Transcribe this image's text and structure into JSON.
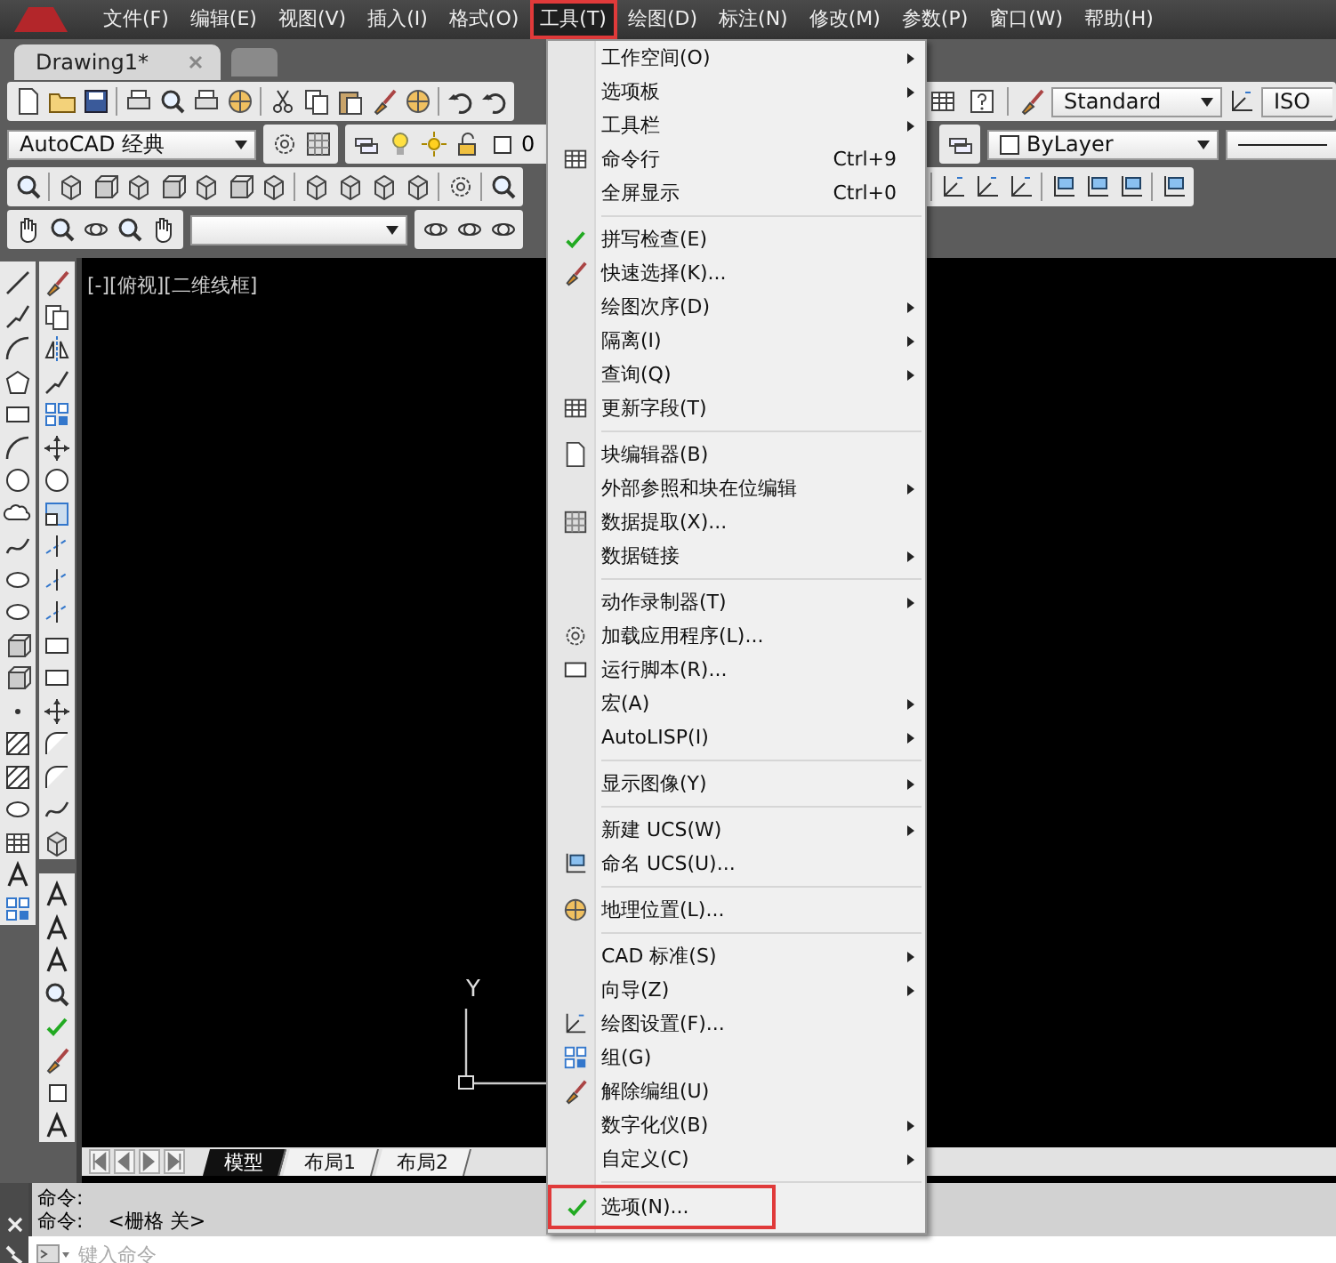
{
  "menu_bar": {
    "items": [
      {
        "label": "文件(F)",
        "selected": false,
        "callout": false
      },
      {
        "label": "编辑(E)",
        "selected": false,
        "callout": false
      },
      {
        "label": "视图(V)",
        "selected": false,
        "callout": false
      },
      {
        "label": "插入(I)",
        "selected": false,
        "callout": false
      },
      {
        "label": "格式(O)",
        "selected": false,
        "callout": false
      },
      {
        "label": "工具(T)",
        "selected": true,
        "callout": true
      },
      {
        "label": "绘图(D)",
        "selected": false,
        "callout": false
      },
      {
        "label": "标注(N)",
        "selected": false,
        "callout": false
      },
      {
        "label": "修改(M)",
        "selected": false,
        "callout": false
      },
      {
        "label": "参数(P)",
        "selected": false,
        "callout": false
      },
      {
        "label": "窗口(W)",
        "selected": false,
        "callout": false
      },
      {
        "label": "帮助(H)",
        "selected": false,
        "callout": false
      }
    ]
  },
  "document_tabs": [
    {
      "label": "Drawing1*",
      "selected": true
    }
  ],
  "toolbars": {
    "text_style": "Standard",
    "dimension_style": "ISO",
    "workspace": "AutoCAD 经典",
    "layer": "0",
    "color_setting": "ByLayer"
  },
  "viewport": {
    "label": "[-][俯视][二维线框]",
    "ucs_axis": "Y"
  },
  "layout_tabs": [
    {
      "label": "模型",
      "selected": true
    },
    {
      "label": "布局1",
      "selected": false
    },
    {
      "label": "布局2",
      "selected": false
    }
  ],
  "command_history": [
    {
      "prompt": "命令:"
    },
    {
      "prompt": "命令:",
      "message": "<栅格 关>"
    }
  ],
  "command_input": {
    "placeholder": "键入命令"
  },
  "tools_menu": {
    "sections": [
      [
        {
          "label": "工作空间(O)",
          "submenu": true,
          "callout": false
        },
        {
          "label": "选项板",
          "submenu": true,
          "callout": false
        },
        {
          "label": "工具栏",
          "submenu": true,
          "callout": false
        },
        {
          "label": "命令行",
          "shortcut": "Ctrl+9",
          "submenu": false,
          "callout": false
        },
        {
          "label": "全屏显示",
          "shortcut": "Ctrl+0",
          "submenu": false,
          "callout": false
        }
      ],
      [
        {
          "label": "拼写检查(E)",
          "submenu": false,
          "callout": false
        },
        {
          "label": "快速选择(K)...",
          "submenu": false,
          "callout": false
        },
        {
          "label": "绘图次序(D)",
          "submenu": true,
          "callout": false
        },
        {
          "label": "隔离(I)",
          "submenu": true,
          "callout": false
        },
        {
          "label": "查询(Q)",
          "submenu": true,
          "callout": false
        },
        {
          "label": "更新字段(T)",
          "submenu": false,
          "callout": false
        }
      ],
      [
        {
          "label": "块编辑器(B)",
          "submenu": false,
          "callout": false
        },
        {
          "label": "外部参照和块在位编辑",
          "submenu": true,
          "callout": false
        },
        {
          "label": "数据提取(X)...",
          "submenu": false,
          "callout": false
        },
        {
          "label": "数据链接",
          "submenu": true,
          "callout": false
        }
      ],
      [
        {
          "label": "动作录制器(T)",
          "submenu": true,
          "callout": false
        },
        {
          "label": "加载应用程序(L)...",
          "submenu": false,
          "callout": false
        },
        {
          "label": "运行脚本(R)...",
          "submenu": false,
          "callout": false
        },
        {
          "label": "宏(A)",
          "submenu": true,
          "callout": false
        },
        {
          "label": "AutoLISP(I)",
          "submenu": true,
          "callout": false
        }
      ],
      [
        {
          "label": "显示图像(Y)",
          "submenu": true,
          "callout": false
        }
      ],
      [
        {
          "label": "新建 UCS(W)",
          "submenu": true,
          "callout": false
        },
        {
          "label": "命名 UCS(U)...",
          "submenu": false,
          "callout": false
        }
      ],
      [
        {
          "label": "地理位置(L)...",
          "submenu": false,
          "callout": false
        }
      ],
      [
        {
          "label": "CAD 标准(S)",
          "submenu": true,
          "callout": false
        },
        {
          "label": "向导(Z)",
          "submenu": true,
          "callout": false
        },
        {
          "label": "绘图设置(F)...",
          "submenu": false,
          "callout": false
        },
        {
          "label": "组(G)",
          "submenu": false,
          "callout": false
        },
        {
          "label": "解除编组(U)",
          "submenu": false,
          "callout": false
        },
        {
          "label": "数字化仪(B)",
          "submenu": true,
          "callout": false
        },
        {
          "label": "自定义(C)",
          "submenu": true,
          "callout": false
        }
      ],
      [
        {
          "label": "选项(N)...",
          "submenu": false,
          "callout": true
        }
      ]
    ]
  }
}
